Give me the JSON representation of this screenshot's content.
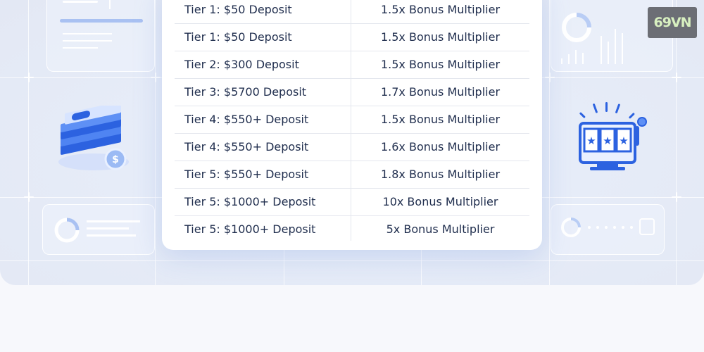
{
  "brand": {
    "logo_text": "69VN"
  },
  "tiers": [
    {
      "deposit": "Tier 1: $50 Deposit",
      "bonus": "1.5x Bonus Multiplier"
    },
    {
      "deposit": "Tier 1: $50 Deposit",
      "bonus": "1.5x Bonus Multiplier"
    },
    {
      "deposit": "Tier 2: $300 Deposit",
      "bonus": "1.5x Bonus Multiplier"
    },
    {
      "deposit": "Tier 3: $5700 Deposit",
      "bonus": "1.7x Bonus Multiplier"
    },
    {
      "deposit": "Tier 4: $550+ Deposit",
      "bonus": "1.5x Bonus Multiplier"
    },
    {
      "deposit": "Tier 4: $550+ Deposit",
      "bonus": "1.6x Bonus Multiplier"
    },
    {
      "deposit": "Tier 5: $550+ Deposit",
      "bonus": "1.8x Bonus Multiplier"
    },
    {
      "deposit": "Tier 5: $1000+ Deposit",
      "bonus": "10x Bonus Multiplier"
    },
    {
      "deposit": "Tier 5: $1000+ Deposit",
      "bonus": "5x Bonus Multiplier"
    }
  ],
  "icons": {
    "left": "money-stack-icon",
    "right": "slot-machine-icon"
  },
  "colors": {
    "accent": "#2f6ee8",
    "text": "#1f2d4d",
    "panel": "#e3e8f4"
  }
}
